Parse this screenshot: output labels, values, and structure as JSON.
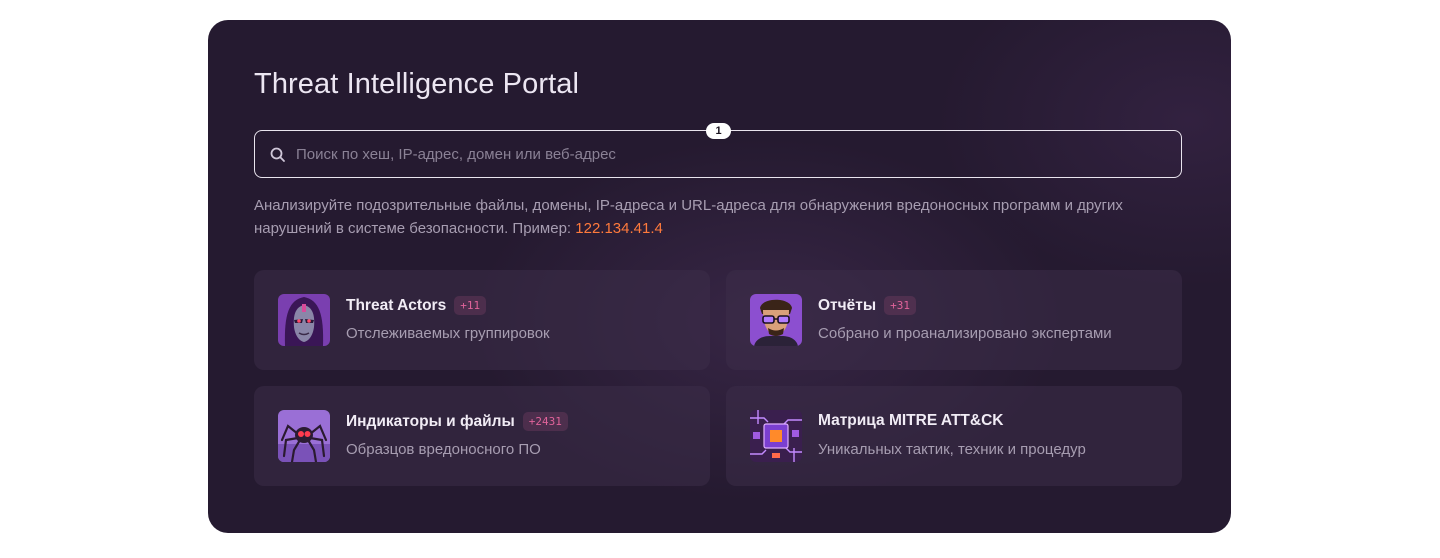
{
  "portal": {
    "title": "Threat Intelligence Portal",
    "search": {
      "placeholder": "Поиск по хеш, IP-адрес, домен или веб-адрес",
      "value": "",
      "step_badge": "1"
    },
    "description": {
      "text": "Анализируйте подозрительные файлы, домены, IP-адреса и URL-адреса для обнаружения вредоносных программ и других нарушений в системе безопасности. Пример: ",
      "example": "122.134.41.4"
    },
    "colors": {
      "accent": "#ff7a3c",
      "badge_text": "#e0639a",
      "panel": "#251a30"
    },
    "cards": [
      {
        "title": "Threat Actors",
        "count": "+11",
        "subtitle": "Отслеживаемых группировок",
        "icon": "hooded-hacker-icon"
      },
      {
        "title": "Отчёты",
        "count": "+31",
        "subtitle": "Собрано и проанализировано экспертами",
        "icon": "analyst-portrait-icon"
      },
      {
        "title": "Индикаторы и файлы",
        "count": "+2431",
        "subtitle": "Образцов вредоносного ПО",
        "icon": "spider-bot-icon"
      },
      {
        "title": "Матрица MITRE ATT&CK",
        "count": "",
        "subtitle": "Уникальных тактик, техник и процедур",
        "icon": "circuit-chip-icon"
      }
    ]
  }
}
